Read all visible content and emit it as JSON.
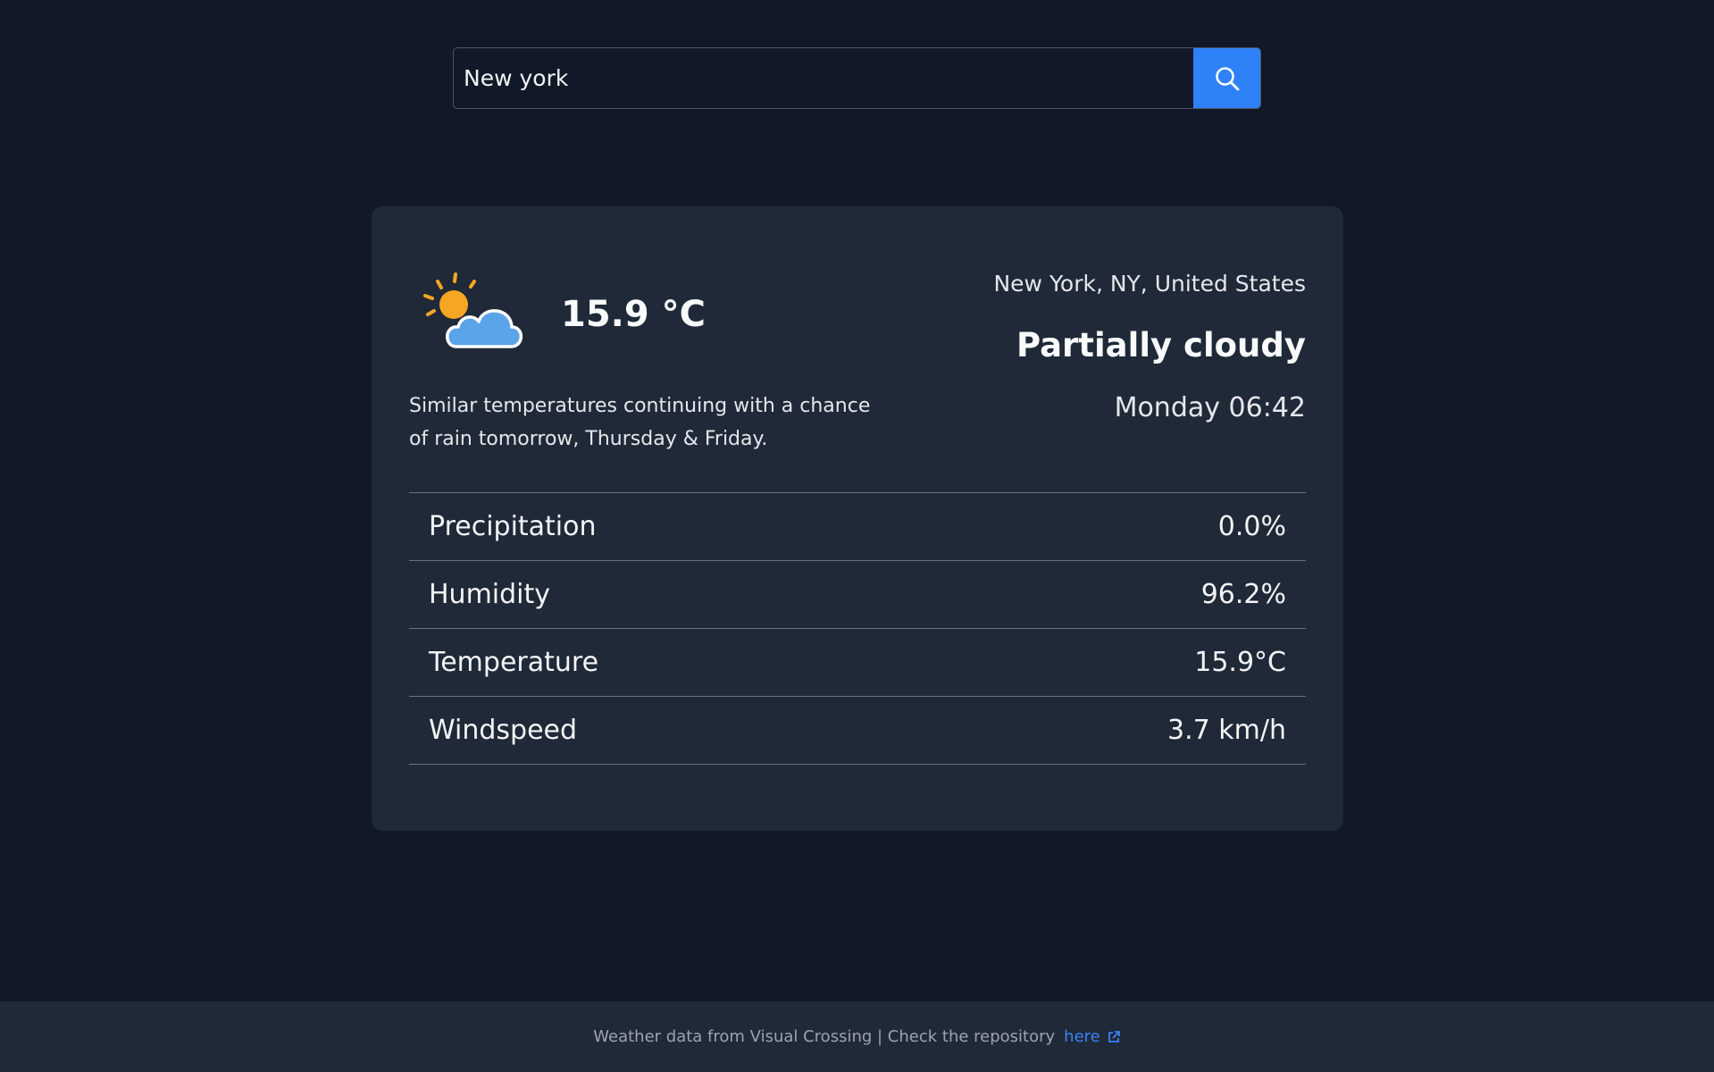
{
  "search": {
    "value": "New york",
    "button_icon": "search-icon"
  },
  "weather": {
    "icon": "partly-cloudy-day-icon",
    "temperature": "15.9 °C",
    "description": "Similar temperatures continuing with a chance of rain tomorrow, Thursday & Friday.",
    "location": "New York, NY, United States",
    "condition": "Partially cloudy",
    "datetime": "Monday 06:42"
  },
  "stats": [
    {
      "label": "Precipitation",
      "value": "0.0%"
    },
    {
      "label": "Humidity",
      "value": "96.2%"
    },
    {
      "label": "Temperature",
      "value": "15.9°C"
    },
    {
      "label": "Windspeed",
      "value": "3.7 km/h"
    }
  ],
  "footer": {
    "text": "Weather data from Visual Crossing | Check the repository",
    "link_label": "here",
    "link_icon": "external-link-icon"
  },
  "colors": {
    "background": "#111827",
    "card": "#1f2937",
    "accent": "#2f81f7",
    "sun": "#f5a623",
    "cloud": "#5ba4ea"
  }
}
